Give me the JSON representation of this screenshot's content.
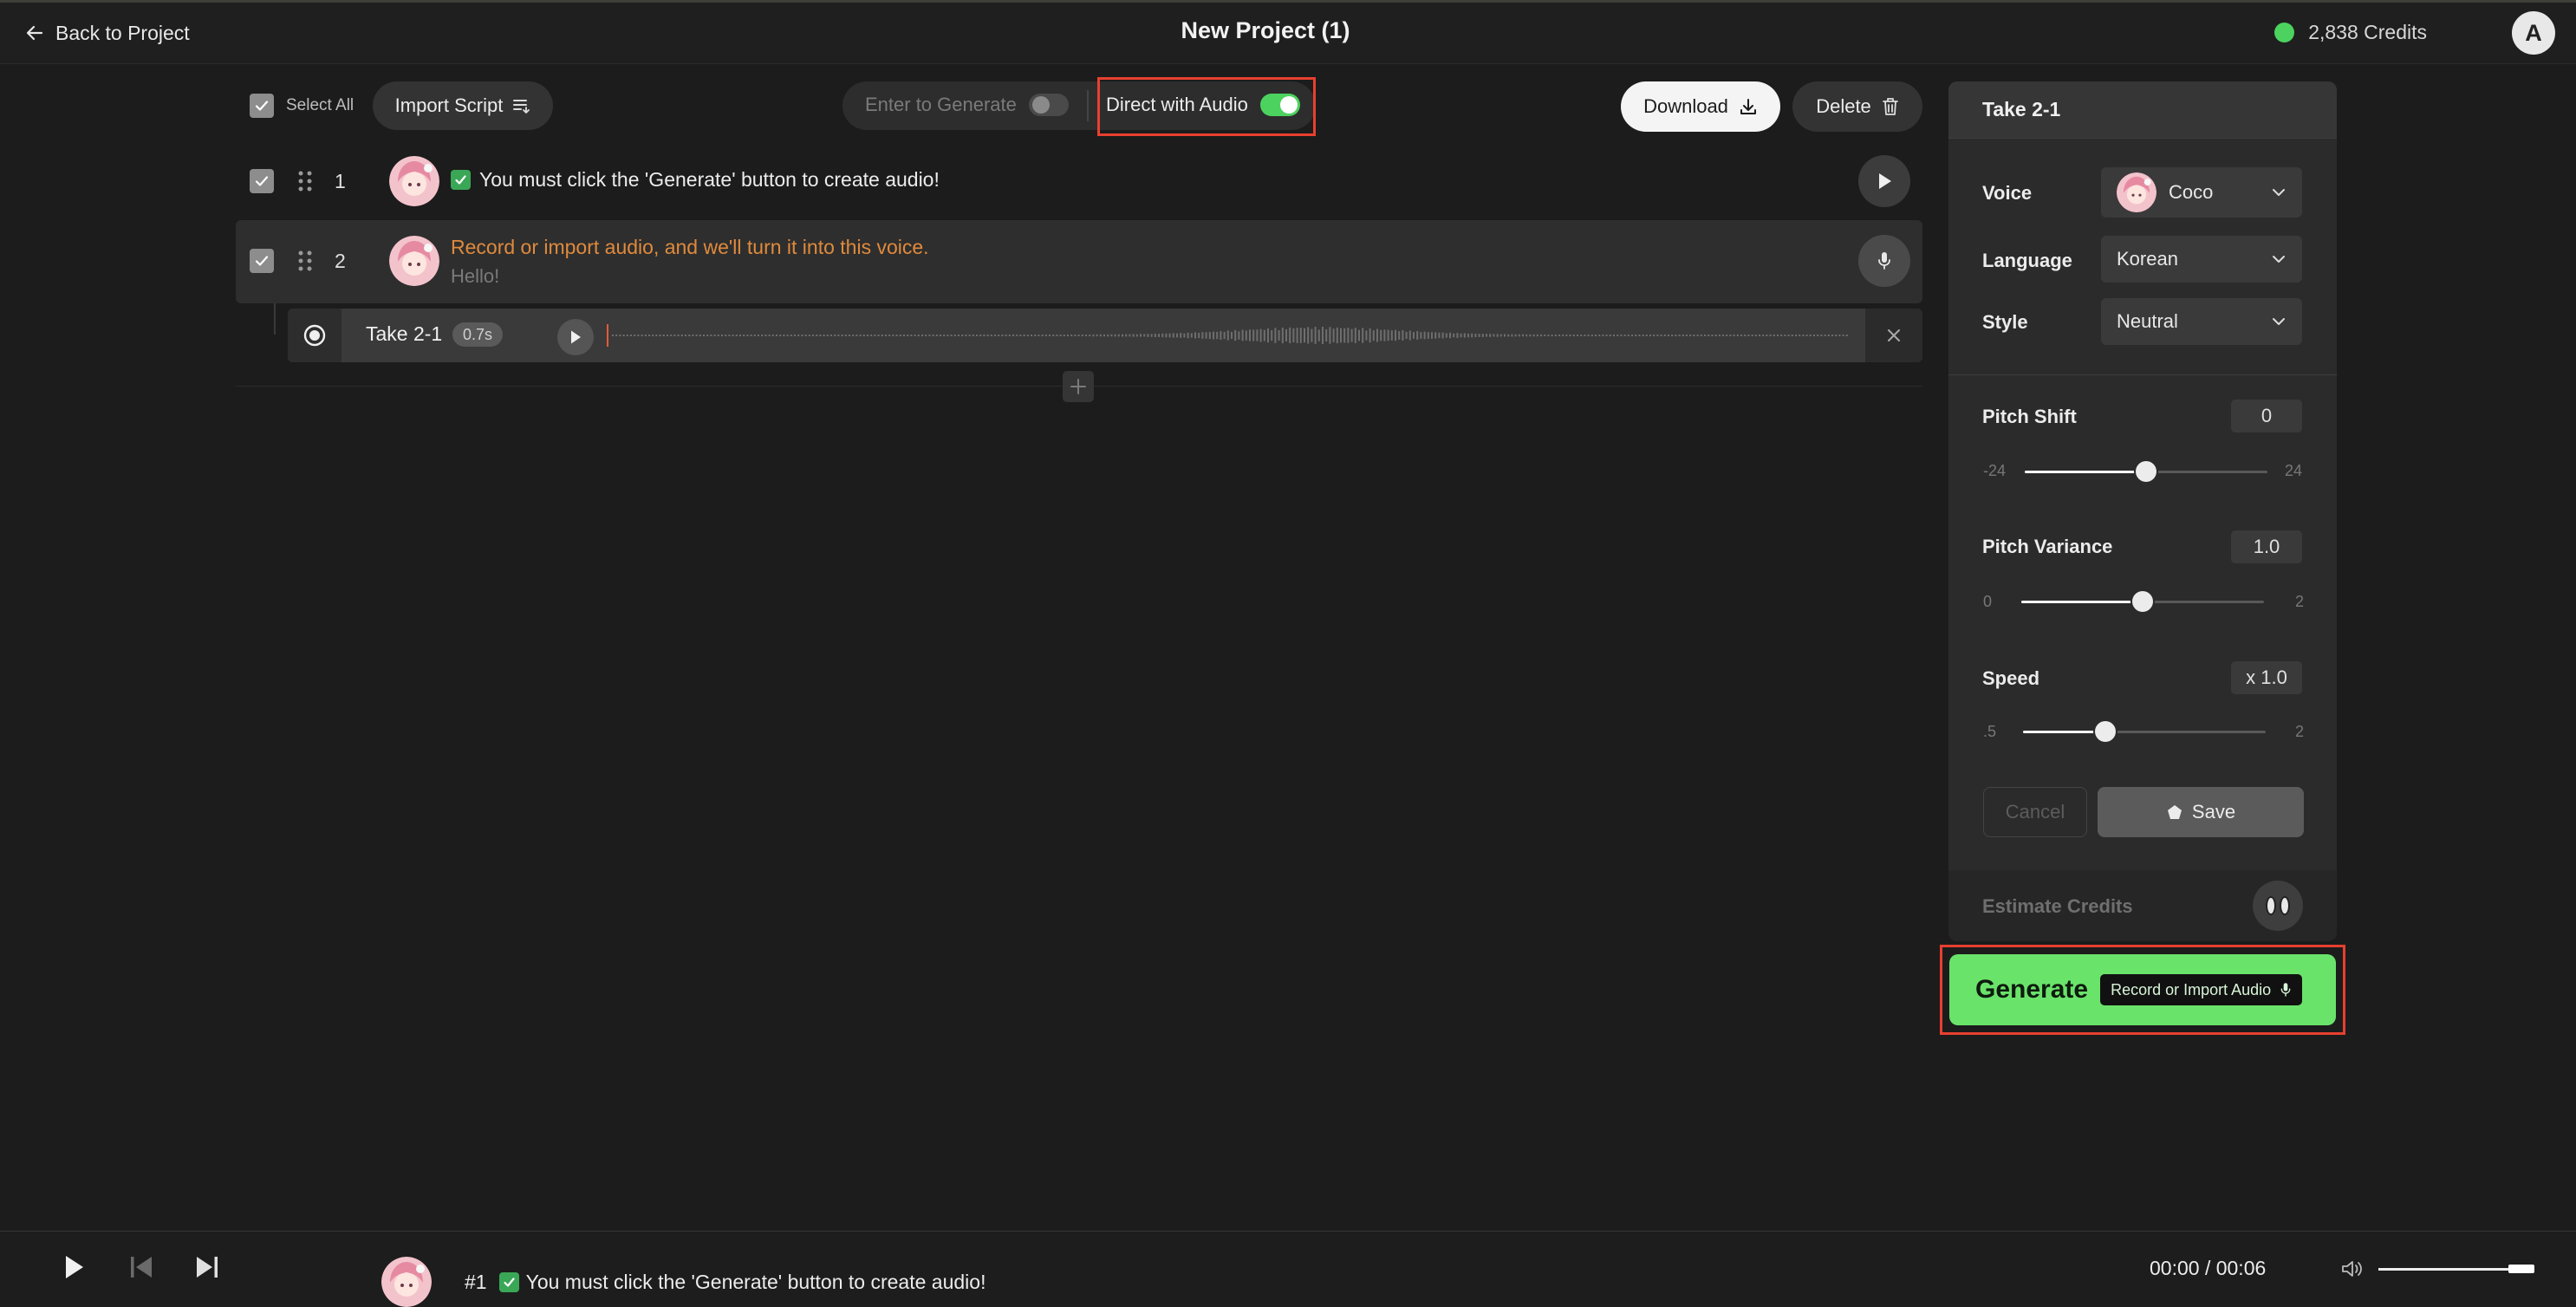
{
  "header": {
    "back_label": "Back to Project",
    "title": "New Project (1)",
    "credits": "2,838 Credits",
    "avatar_letter": "A",
    "status_color": "#4cd35f"
  },
  "toolbar": {
    "select_all": "Select All",
    "import_script": "Import Script",
    "enter_to_generate": "Enter to Generate",
    "enter_to_generate_on": false,
    "direct_with_audio": "Direct with Audio",
    "direct_with_audio_on": true,
    "download": "Download",
    "delete": "Delete"
  },
  "rows": [
    {
      "number": "1",
      "text": "You must click the 'Generate' button to create audio!",
      "checked": true
    },
    {
      "number": "2",
      "text": "Record or import audio, and we'll turn it into this voice.",
      "sub_text": "Hello!",
      "checked": true,
      "take": {
        "label": "Take 2-1",
        "duration": "0.7s"
      }
    }
  ],
  "panel": {
    "title": "Take 2-1",
    "voice": {
      "label": "Voice",
      "value": "Coco"
    },
    "language": {
      "label": "Language",
      "value": "Korean"
    },
    "style": {
      "label": "Style",
      "value": "Neutral"
    },
    "pitch_shift": {
      "label": "Pitch Shift",
      "value": "0",
      "min": "-24",
      "max": "24",
      "level": 0.5
    },
    "pitch_variance": {
      "label": "Pitch Variance",
      "value": "1.0",
      "min": "0",
      "max": "2",
      "level": 0.5
    },
    "speed": {
      "label": "Speed",
      "value": "x 1.0",
      "min": ".5",
      "max": "2",
      "level": 0.34
    },
    "cancel": "Cancel",
    "save": "Save",
    "estimate_credits": "Estimate Credits",
    "generate": "Generate",
    "generate_chip": "Record or Import Audio",
    "accent_color": "#6ae36b"
  },
  "player": {
    "number": "#1",
    "text": "You must click the 'Generate' button to create audio!",
    "time": "00:00 / 00:06",
    "volume_level": 1.0
  }
}
